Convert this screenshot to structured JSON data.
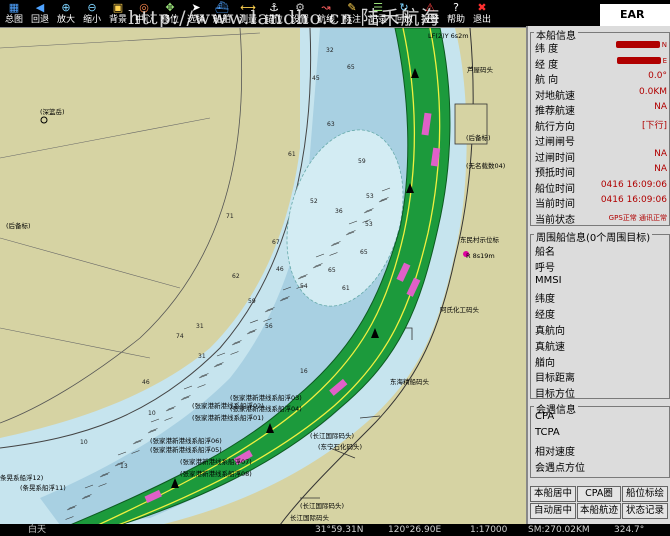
{
  "toolbar": {
    "buttons": [
      {
        "label": "总图",
        "icon": "overview-icon"
      },
      {
        "label": "回退",
        "icon": "back-arrow-icon"
      },
      {
        "label": "放大",
        "icon": "zoom-in-icon"
      },
      {
        "label": "缩小",
        "icon": "zoom-out-icon"
      },
      {
        "label": "背景",
        "icon": "background-icon"
      },
      {
        "label": "中心",
        "icon": "center-icon"
      },
      {
        "label": "移位",
        "icon": "pan-icon"
      },
      {
        "label": "选择",
        "icon": "select-icon"
      },
      {
        "label": "船舶",
        "icon": "ship-icon"
      },
      {
        "label": "测量",
        "icon": "measure-icon"
      },
      {
        "label": "锚位",
        "icon": "anchor-icon"
      },
      {
        "label": "设置",
        "icon": "settings-icon"
      },
      {
        "label": "航线",
        "icon": "route-icon"
      },
      {
        "label": "标注",
        "icon": "annotate-icon"
      },
      {
        "label": "记录",
        "icon": "log-icon"
      },
      {
        "label": "回放",
        "icon": "replay-icon"
      },
      {
        "label": "报警",
        "icon": "alarm-icon"
      },
      {
        "label": "帮助",
        "icon": "help-icon"
      },
      {
        "label": "退出",
        "icon": "exit-icon"
      }
    ],
    "watermark": "http://www.landho.cn 陆禾航海",
    "brand": "EAR"
  },
  "colors": {
    "land": "#d6d3a3",
    "deep_water": "#a8d0e2",
    "shallow_water": "#c6e4ee",
    "fairway": "#1c9a3c",
    "fairway_line": "#f0f040",
    "highlight": "#e060c8",
    "alert_red": "#b00000"
  },
  "chart": {
    "labels": [
      {
        "text": "LF(2)Y 6s2m"
      },
      {
        "text": "芦屋码头"
      },
      {
        "text": "(深篮岳)"
      },
      {
        "text": "(后备标)"
      },
      {
        "text": "(后备标)"
      },
      {
        "text": "(无名载数04)"
      },
      {
        "text": "东民村示位标"
      },
      {
        "text": "R 8s19m"
      },
      {
        "text": "阿氏化工码头"
      },
      {
        "text": "东海精船码头"
      },
      {
        "text": "(张家港新港线系船浮02)"
      },
      {
        "text": "(张家港新港线系船浮01)"
      },
      {
        "text": "(张家港新港线系船浮06)"
      },
      {
        "text": "(张家港新港线系船浮05)"
      },
      {
        "text": "(张家港新港线系船浮07)"
      },
      {
        "text": "(张家港新港线系船浮08)"
      },
      {
        "text": "(长江国际码头)"
      },
      {
        "text": "(东宁石化码头)"
      },
      {
        "text": "长江国际码头"
      },
      {
        "text": "(长江国际码头)"
      },
      {
        "text": "条晃系船浮12)"
      },
      {
        "text": "(条晃系船浮11)"
      },
      {
        "text": "(张家港新港线系船浮03)"
      },
      {
        "text": "(张家港新港线系船浮04)"
      }
    ],
    "soundings": [
      "32",
      "65",
      "45",
      "53",
      "63",
      "59",
      "61",
      "52",
      "36",
      "71",
      "67",
      "53",
      "65",
      "54",
      "46",
      "62",
      "59",
      "56",
      "31",
      "61",
      "31",
      "46",
      "74",
      "10",
      "10",
      "65",
      "16",
      "13"
    ]
  },
  "panel": {
    "own_ship": {
      "title": "本船信息",
      "fields": [
        {
          "key": "纬    度",
          "value": "N",
          "redacted": true
        },
        {
          "key": "经    度",
          "value": "E",
          "redacted": true
        },
        {
          "key": "航    向",
          "value": "0.0°"
        },
        {
          "key": "对地航速",
          "value": "0.0KM"
        },
        {
          "key": "推荐航速",
          "value": "NA"
        },
        {
          "key": "航行方向",
          "value": "[下行]"
        },
        {
          "key": "过闸闸号",
          "value": ""
        },
        {
          "key": "过闸时间",
          "value": "NA"
        },
        {
          "key": "预抵时间",
          "value": "NA"
        },
        {
          "key": "船位时间",
          "value": "0416 16:09:06"
        },
        {
          "key": "当前时间",
          "value": "0416 16:09:06"
        },
        {
          "key": "当前状态",
          "value": "GPS正常 通讯正常"
        }
      ]
    },
    "nearby": {
      "title": "周围船信息(0个周围目标)",
      "fields": [
        "船名",
        "呼号",
        "MMSI",
        "纬度",
        "经度",
        "真航向",
        "真航速",
        "艏向",
        "目标距离",
        "目标方位"
      ]
    },
    "encounter": {
      "title": "会遇信息",
      "fields": [
        "CPA",
        "TCPA",
        "相对速度",
        "会遇点方位"
      ]
    },
    "buttons": [
      [
        "本船居中",
        "CPA圈",
        "船位标绘"
      ],
      [
        "自动居中",
        "本船航迹",
        "状态记录"
      ]
    ]
  },
  "status": {
    "mode": "白天",
    "lat": "31°59.31N",
    "lon": "120°26.90E",
    "scale": "1:17000",
    "range": "SM:270.02KM",
    "bearing": "324.7°"
  }
}
